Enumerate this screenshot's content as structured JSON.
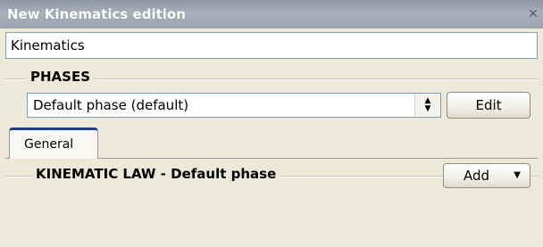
{
  "window": {
    "title": "New Kinematics edition",
    "close_glyph": "✕"
  },
  "name_field": {
    "value": "Kinematics"
  },
  "phases": {
    "group_label": "PHASES",
    "selected": "Default phase (default)",
    "edit_label": "Edit"
  },
  "tabs": [
    {
      "label": "General",
      "active": true
    }
  ],
  "law": {
    "group_label": "KINEMATIC LAW - Default phase",
    "add_label": "Add"
  },
  "colors": {
    "titlebar": "#9ea4b1",
    "window_bg": "#ece9d8",
    "tab_accent": "#1a3f88"
  }
}
